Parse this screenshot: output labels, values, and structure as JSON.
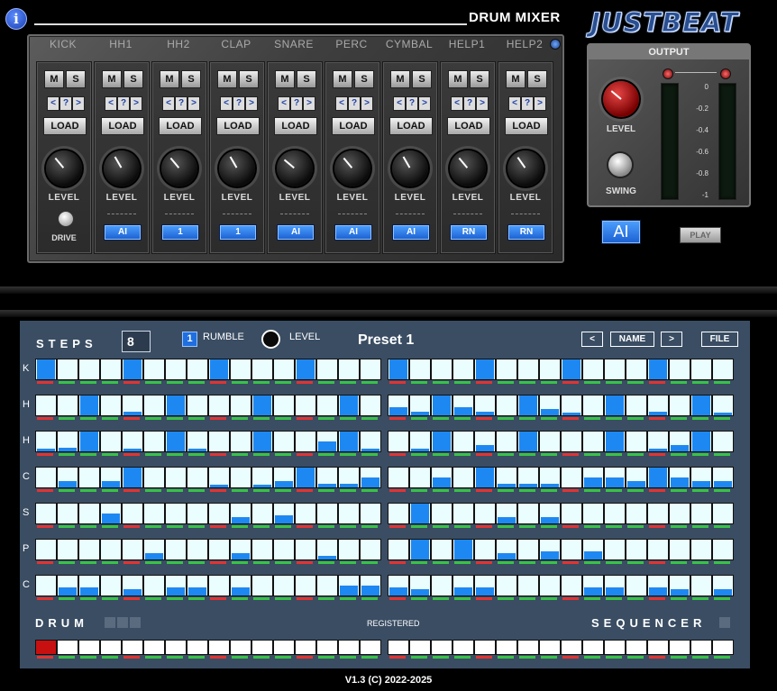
{
  "header": {
    "info_icon": "i",
    "title": "DRUM MIXER",
    "logo": "JUSTBEAT"
  },
  "mixer": {
    "channels": [
      {
        "name": "KICK",
        "mute": "M",
        "solo": "S",
        "nav": [
          "<",
          "?",
          ">"
        ],
        "load": "LOAD",
        "level_label": "LEVEL",
        "extra": "DRIVE",
        "button": ""
      },
      {
        "name": "HH1",
        "mute": "M",
        "solo": "S",
        "nav": [
          "<",
          "?",
          ">"
        ],
        "load": "LOAD",
        "level_label": "LEVEL",
        "button": "AI"
      },
      {
        "name": "HH2",
        "mute": "M",
        "solo": "S",
        "nav": [
          "<",
          "?",
          ">"
        ],
        "load": "LOAD",
        "level_label": "LEVEL",
        "button": "1"
      },
      {
        "name": "CLAP",
        "mute": "M",
        "solo": "S",
        "nav": [
          "<",
          "?",
          ">"
        ],
        "load": "LOAD",
        "level_label": "LEVEL",
        "button": "1"
      },
      {
        "name": "SNARE",
        "mute": "M",
        "solo": "S",
        "nav": [
          "<",
          "?",
          ">"
        ],
        "load": "LOAD",
        "level_label": "LEVEL",
        "button": "AI"
      },
      {
        "name": "PERC",
        "mute": "M",
        "solo": "S",
        "nav": [
          "<",
          "?",
          ">"
        ],
        "load": "LOAD",
        "level_label": "LEVEL",
        "button": "AI"
      },
      {
        "name": "CYMBAL",
        "mute": "M",
        "solo": "S",
        "nav": [
          "<",
          "?",
          ">"
        ],
        "load": "LOAD",
        "level_label": "LEVEL",
        "button": "AI"
      },
      {
        "name": "HELP1",
        "mute": "M",
        "solo": "S",
        "nav": [
          "<",
          "?",
          ">"
        ],
        "load": "LOAD",
        "level_label": "LEVEL",
        "button": "RN"
      },
      {
        "name": "HELP2",
        "mute": "M",
        "solo": "S",
        "nav": [
          "<",
          "?",
          ">"
        ],
        "load": "LOAD",
        "level_label": "LEVEL",
        "button": "RN"
      }
    ]
  },
  "output": {
    "title": "OUTPUT",
    "level_label": "LEVEL",
    "swing_label": "SWING",
    "db_scale": [
      "0",
      "-0.2",
      "-0.4",
      "-0.6",
      "-0.8",
      "-1"
    ],
    "ai_button": "AI",
    "play_button": "PLAY"
  },
  "sequencer": {
    "steps_label": "STEPS",
    "steps_value": "8",
    "rumble_check": "1",
    "rumble_label": "RUMBLE",
    "level_label": "LEVEL",
    "preset_name": "Preset 1",
    "prev_button": "<",
    "name_button": "NAME",
    "next_button": ">",
    "file_button": "FILE",
    "drum_label": "DRUM",
    "registered_label": "REGISTERED",
    "sequencer_label": "SEQUENCER",
    "rows": [
      {
        "label": "K",
        "values": [
          1,
          0,
          0,
          0,
          1,
          0,
          0,
          0,
          1,
          0,
          0,
          0,
          1,
          0,
          0,
          0,
          1,
          0,
          0,
          0,
          1,
          0,
          0,
          0,
          1,
          0,
          0,
          0,
          1,
          0,
          0,
          0
        ]
      },
      {
        "label": "H",
        "values": [
          0,
          0,
          1,
          0,
          0.2,
          0,
          1,
          0,
          0,
          0,
          1,
          0,
          0,
          0,
          1,
          0,
          0.4,
          0.2,
          1,
          0.4,
          0.2,
          0,
          1,
          0.3,
          0.1,
          0,
          1,
          0,
          0.2,
          0,
          1,
          0.1
        ]
      },
      {
        "label": "H",
        "values": [
          0.1,
          0.2,
          1,
          0,
          0.1,
          0,
          1,
          0.1,
          0,
          0,
          1,
          0,
          0,
          0.5,
          1,
          0.1,
          0,
          0.1,
          1,
          0,
          0.3,
          0,
          1,
          0,
          0,
          0,
          1,
          0,
          0.1,
          0.3,
          1,
          0
        ]
      },
      {
        "label": "C",
        "values": [
          0,
          0.3,
          0,
          0.3,
          1,
          0,
          0,
          0,
          0.1,
          0,
          0.1,
          0.3,
          1,
          0.2,
          0.2,
          0.5,
          0,
          0,
          0.5,
          0,
          1,
          0.2,
          0.2,
          0.2,
          0,
          0.5,
          0.5,
          0.3,
          1,
          0.5,
          0.3,
          0.3
        ]
      },
      {
        "label": "S",
        "values": [
          0,
          0,
          0,
          0.5,
          0,
          0,
          0,
          0,
          0,
          0.3,
          0,
          0.4,
          0,
          0,
          0,
          0,
          0,
          1,
          0,
          0,
          0,
          0.3,
          0,
          0.3,
          0,
          0,
          0,
          0,
          0,
          0,
          0,
          0
        ]
      },
      {
        "label": "P",
        "values": [
          0,
          0,
          0,
          0,
          0,
          0.3,
          0,
          0,
          0,
          0.3,
          0,
          0,
          0,
          0.2,
          0,
          0,
          0,
          1,
          0,
          1,
          0,
          0.3,
          0,
          0.4,
          0,
          0.4,
          0,
          0,
          0,
          0,
          0,
          0
        ]
      },
      {
        "label": "C",
        "values": [
          0,
          0.4,
          0.4,
          0,
          0.3,
          0,
          0.4,
          0.4,
          0,
          0.4,
          0,
          0,
          0,
          0,
          0.5,
          0.5,
          0.4,
          0.3,
          0,
          0.4,
          0.4,
          0,
          0,
          0,
          0,
          0.4,
          0.4,
          0,
          0.4,
          0.3,
          0,
          0.3
        ]
      }
    ],
    "pattern_selected": 0
  },
  "footer": {
    "version": "V1.3 (C) 2022-2025"
  }
}
